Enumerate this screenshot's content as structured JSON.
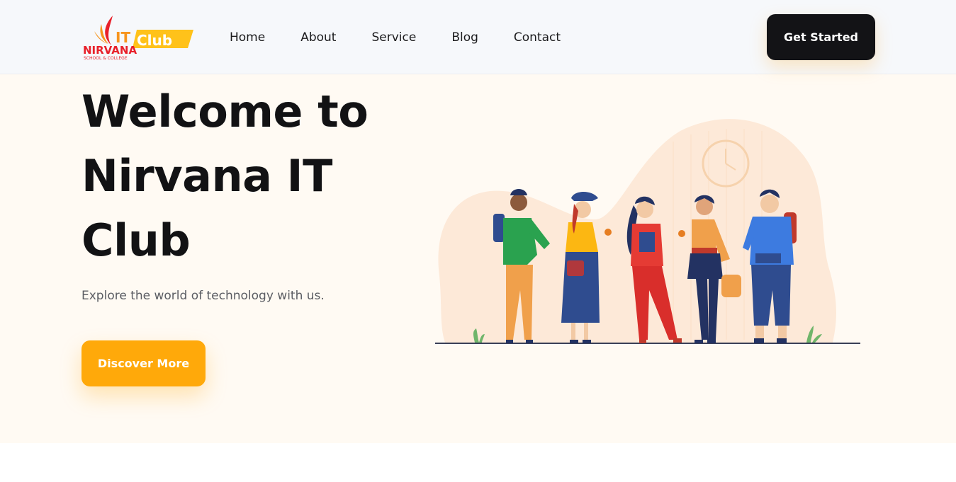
{
  "logo": {
    "text_nirvana": "NIRVANA",
    "text_it": "IT",
    "text_club": "Club",
    "text_sub": "SCHOOL & COLLEGE"
  },
  "nav": {
    "items": [
      "Home",
      "About",
      "Service",
      "Blog",
      "Contact"
    ]
  },
  "header": {
    "cta_label": "Get Started"
  },
  "hero": {
    "title_lines": [
      "Welcome to",
      "Nirvana IT",
      "Club"
    ],
    "subtitle": "Explore the world of technology with us.",
    "cta_label": "Discover More"
  },
  "colors": {
    "accent": "#ffa90a",
    "dark": "#131316",
    "hero_bg": "#fffaf3",
    "header_bg": "#f6f8fb"
  },
  "illustration": {
    "icon": "group-of-students-illustration"
  }
}
